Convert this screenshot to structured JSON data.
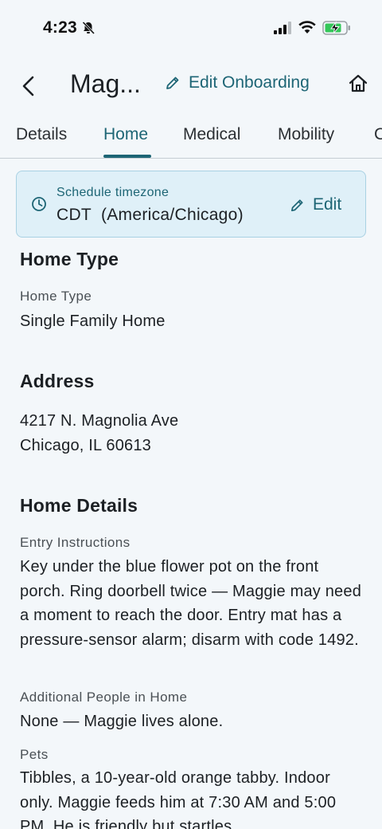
{
  "status_bar": {
    "time": "4:23",
    "icons": [
      "bell-slash-icon",
      "cellular-signal-icon",
      "wifi-icon",
      "battery-charging-icon"
    ]
  },
  "header": {
    "client_name": "Mag...",
    "edit_onboarding_label": "Edit Onboarding",
    "icons": [
      "chevron-left-icon",
      "pencil-icon",
      "home-icon"
    ]
  },
  "tabs": [
    {
      "label": "Details",
      "active": false
    },
    {
      "label": "Home",
      "active": true
    },
    {
      "label": "Medical",
      "active": false
    },
    {
      "label": "Mobility",
      "active": false
    },
    {
      "label": "C",
      "active": false
    }
  ],
  "timezone": {
    "label": "Schedule timezone",
    "value": "CDT  (America/Chicago)",
    "edit_label": "Edit"
  },
  "home_type": {
    "title": "Home Type",
    "label": "Home Type",
    "value": "Single Family Home"
  },
  "address": {
    "title": "Address",
    "line1": "4217 N. Magnolia Ave",
    "line2": "Chicago, IL 60613"
  },
  "home_details": {
    "title": "Home Details",
    "entry_label": "Entry Instructions",
    "entry_value": "Key under the blue flower pot on the front porch. Ring doorbell twice — Maggie may need a moment to reach the door. Entry mat has a pressure-sensor alarm; disarm with code 1492.",
    "people_label": "Additional People in Home",
    "people_value": "None — Maggie lives alone.",
    "pets_label": "Pets",
    "pets_value": "Tibbles, a 10-year-old orange tabby. Indoor only. Maggie feeds him at 7:30 AM and 5:00 PM. He is friendly but startles"
  },
  "colors": {
    "accent": "#1d6575",
    "background": "#f3f7fa",
    "card_bg": "#dff0f8",
    "card_border": "#a9d1e3"
  }
}
